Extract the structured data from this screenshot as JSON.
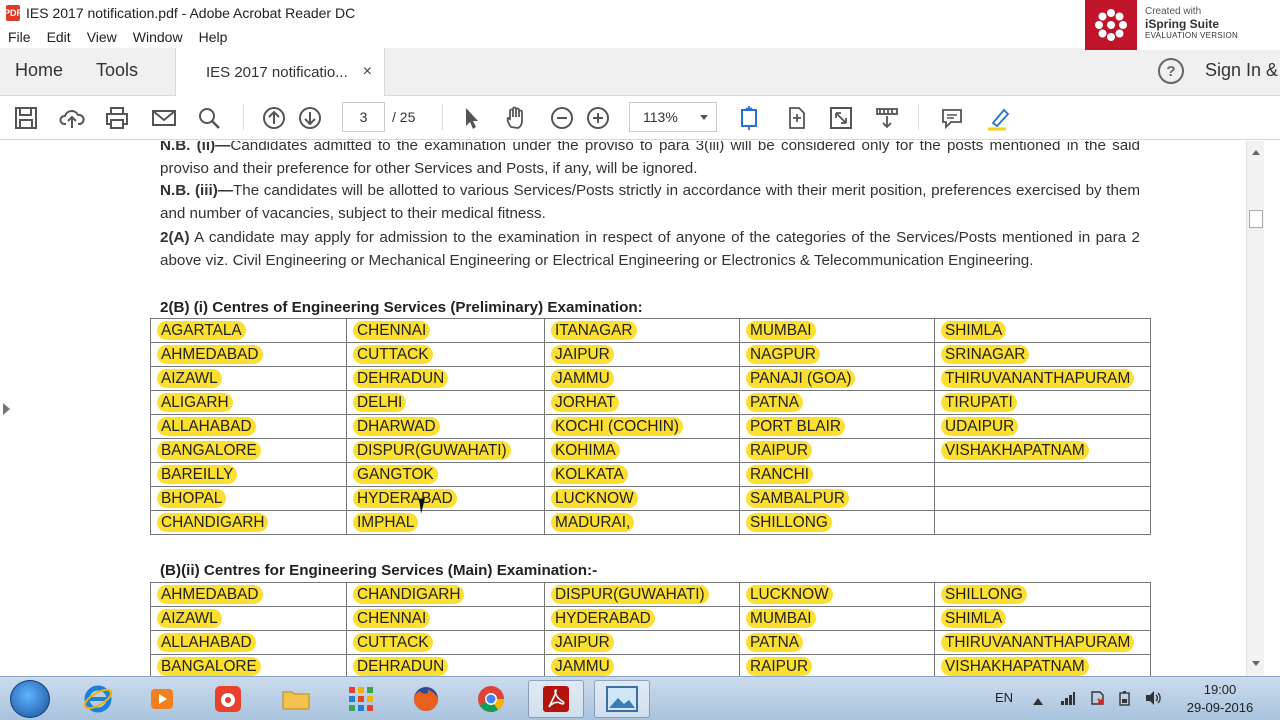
{
  "window": {
    "title": "IES 2017 notification.pdf - Adobe Acrobat Reader DC",
    "pdf_icon_text": "PDF"
  },
  "watermark": {
    "line1": "Created with",
    "line2": "iSpring Suite",
    "line3": "EVALUATION VERSION"
  },
  "menu": [
    "File",
    "Edit",
    "View",
    "Window",
    "Help"
  ],
  "tabs": {
    "home": "Home",
    "tools": "Tools",
    "document": "IES 2017 notificatio...",
    "close": "×",
    "help": "?",
    "sign_in": "Sign In &"
  },
  "toolbar": {
    "page_current": "3",
    "page_total": "/ 25",
    "zoom": "113%"
  },
  "document": {
    "nb_ii_prefix": "N.B. (ii)—",
    "nb_ii_text": "Candidates admitted to the examination under the proviso to para 3(iii) will be considered only for the posts mentioned in the said proviso and their preference for other Services and Posts, if any, will be ignored.",
    "nb_iii_prefix": "N.B. (iii)—",
    "nb_iii_text": "The candidates will be allotted to various Services/Posts strictly in accordance with their merit position, preferences exercised by them and number of vacancies, subject to their medical fitness.",
    "p2a_prefix": "2(A)",
    "p2a_text": " A candidate may apply for admission to the examination in respect of anyone of the categories of the Services/Posts mentioned in para 2 above viz. Civil Engineering or Mechanical Engineering or Electrical Engineering or Electronics & Telecommunication Engineering.",
    "prelim_heading": "2(B) (i) Centres of Engineering Services (Preliminary) Examination:",
    "prelim_rows": [
      [
        "AGARTALA",
        "CHENNAI",
        "ITANAGAR",
        "MUMBAI",
        "SHIMLA"
      ],
      [
        "AHMEDABAD",
        "CUTTACK",
        "JAIPUR",
        "NAGPUR",
        "SRINAGAR"
      ],
      [
        "AIZAWL",
        "DEHRADUN",
        "JAMMU",
        "PANAJI (GOA)",
        "THIRUVANANTHAPURAM"
      ],
      [
        "ALIGARH",
        "DELHI",
        "JORHAT",
        "PATNA",
        "TIRUPATI"
      ],
      [
        "ALLAHABAD",
        "DHARWAD",
        "KOCHI (COCHIN)",
        "PORT BLAIR",
        "UDAIPUR"
      ],
      [
        "BANGALORE",
        "DISPUR(GUWAHATI)",
        "KOHIMA",
        "RAIPUR",
        "VISHAKHAPATNAM"
      ],
      [
        "BAREILLY",
        "GANGTOK",
        "KOLKATA",
        "RANCHI",
        ""
      ],
      [
        "BHOPAL",
        "HYDERABAD",
        "LUCKNOW",
        "SAMBALPUR",
        ""
      ],
      [
        "CHANDIGARH",
        "IMPHAL",
        "MADURAI,",
        "SHILLONG",
        ""
      ]
    ],
    "main_heading": "(B)(ii) Centres for Engineering Services (Main) Examination:-",
    "main_rows": [
      [
        "AHMEDABAD",
        "CHANDIGARH",
        "DISPUR(GUWAHATI)",
        "LUCKNOW",
        "SHILLONG"
      ],
      [
        "AIZAWL",
        "CHENNAI",
        "HYDERABAD",
        "MUMBAI",
        "SHIMLA"
      ],
      [
        "ALLAHABAD",
        "CUTTACK",
        "JAIPUR",
        "PATNA",
        "THIRUVANANTHAPURAM"
      ],
      [
        "BANGALORE",
        "DEHRADUN",
        "JAMMU",
        "RAIPUR",
        "VISHAKHAPATNAM"
      ]
    ]
  },
  "taskbar": {
    "language": "EN",
    "time": "19:00",
    "date": "29-09-2016"
  }
}
